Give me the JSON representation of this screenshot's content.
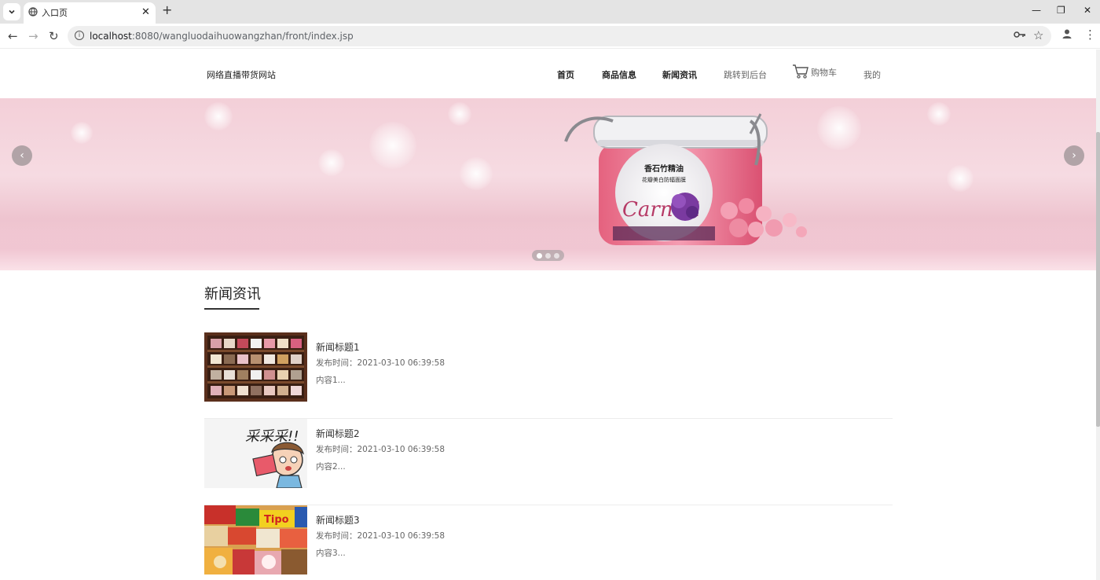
{
  "browser": {
    "tab_title": "入口页",
    "url_host": "localhost",
    "url_rest": ":8080/wangluodaihuowangzhan/front/index.jsp"
  },
  "site": {
    "brand": "网络直播带货网站",
    "nav": [
      "首页",
      "商品信息",
      "新闻资讯",
      "跳转到后台",
      "购物车",
      "我的"
    ]
  },
  "banner": {
    "jar_label_line1": "香石竹精油",
    "jar_label_line2": "花瓣美白防辐面膜",
    "jar_script": "Carnati",
    "slide_count": 3,
    "active_slide": 1
  },
  "news": {
    "section_title": "新闻资讯",
    "items": [
      {
        "title": "新闻标题1",
        "time": "发布时间：2021-03-10 06:39:58",
        "content": "内容1..."
      },
      {
        "title": "新闻标题2",
        "time": "发布时间：2021-03-10 06:39:58",
        "content": "内容2..."
      },
      {
        "title": "新闻标题3",
        "time": "发布时间：2021-03-10 06:39:58",
        "content": "内容3..."
      }
    ]
  },
  "colors": {
    "banner_pink": "#f3cfd8",
    "jar_pink": "#e8798f",
    "flower_purple": "#7a3aa0"
  }
}
